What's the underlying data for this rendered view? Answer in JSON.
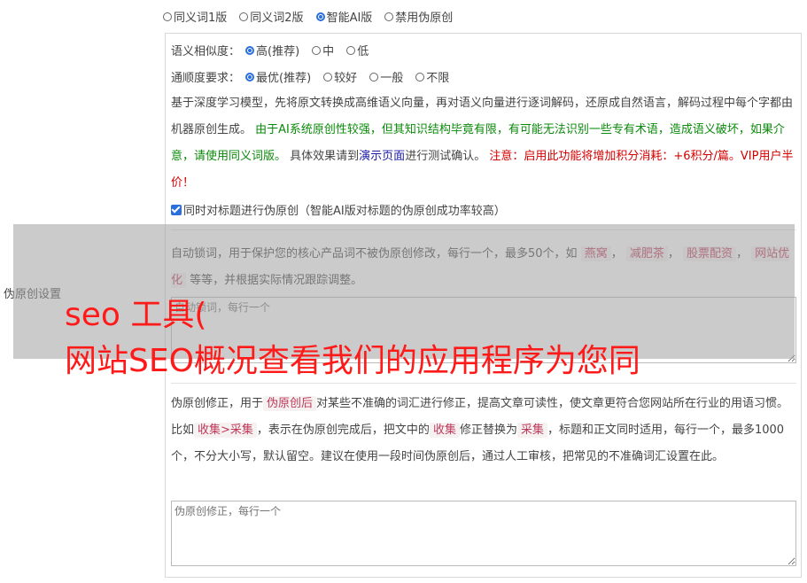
{
  "versions": [
    {
      "label": "同义词1版",
      "selected": false
    },
    {
      "label": "同义词2版",
      "selected": false
    },
    {
      "label": "智能AI版",
      "selected": true
    },
    {
      "label": "禁用伪原创",
      "selected": false
    }
  ],
  "side_label": "伪原创设置",
  "similarity": {
    "label": "语义相似度：",
    "options": [
      {
        "label": "高(推荐)",
        "selected": true
      },
      {
        "label": "中",
        "selected": false
      },
      {
        "label": "低",
        "selected": false
      }
    ]
  },
  "fluency": {
    "label": "通顺度要求：",
    "options": [
      {
        "label": "最优(推荐)",
        "selected": true
      },
      {
        "label": "较好",
        "selected": false
      },
      {
        "label": "一般",
        "selected": false
      },
      {
        "label": "不限",
        "selected": false
      }
    ]
  },
  "ai_desc": {
    "part1": "基于深度学习模型，先将原文转换成高维语义向量，再对语义向量进行逐词解码，还原成自然语言，解码过程中每个字都由机器原创生成。",
    "green": "由于AI系统原创性较强，但其知识结构毕竟有限，有可能无法识别一些专有术语，造成语义破坏，如果介意，请使用同义词版。",
    "part2": "具体效果请到",
    "link": "演示页面",
    "part3": "进行测试确认。",
    "red": "注意：启用此功能将增加积分消耗：+6积分/篇。VIP用户半价！"
  },
  "title_checkbox": {
    "label": "同时对标题进行伪原创（智能AI版对标题的伪原创成功率较高）",
    "checked": true
  },
  "lock_words": {
    "desc_before": "自动锁词，用于保护您的核心产品词不被伪原创修改，每行一个，最多50个，如",
    "tags": [
      "燕窝",
      "减肥茶",
      "股票配资",
      "网站优化"
    ],
    "desc_after": "等等，并根据实际情况跟踪调整。",
    "placeholder": "自动锁词，每行一个"
  },
  "correction": {
    "desc1": "伪原创修正，用于",
    "tag1": "伪原创后",
    "desc2": "对某些不准确的词汇进行修正，提高文章可读性，使文章更符合您网站所在行业的用语习惯。比如",
    "tag2": "收集>采集",
    "desc3": "，表示在伪原创完成后，把文中的",
    "tag3": "收集",
    "desc4": "修正替换为",
    "tag4": "采集",
    "desc5": "，标题和正文同时适用，每行一个，最多1000个，不分大小写，默认留空。建议在使用一段时间伪原创后，通过人工审核，把常见的不准确词汇设置在此。",
    "placeholder": "伪原创修正，每行一个"
  },
  "overlay": {
    "line1": "seo 工具(",
    "line2": "网站SEO概况查看我们的应用程序为您同"
  },
  "colors": {
    "accent": "#2a6fdb",
    "green": "#0a8a0a",
    "red": "#d40000",
    "overlay_text": "#ff1a1a"
  }
}
